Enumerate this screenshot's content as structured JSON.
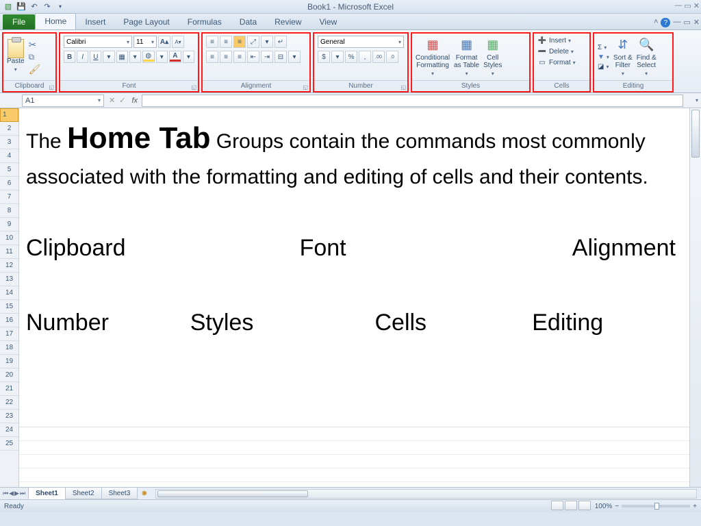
{
  "title": "Book1  -  Microsoft Excel",
  "tabs": {
    "file": "File",
    "list": [
      "Home",
      "Insert",
      "Page Layout",
      "Formulas",
      "Data",
      "Review",
      "View"
    ],
    "active": "Home"
  },
  "ribbon": {
    "clipboard": {
      "label": "Clipboard",
      "paste": "Paste"
    },
    "font": {
      "label": "Font",
      "name": "Calibri",
      "size": "11",
      "bold": "B",
      "italic": "I",
      "underline": "U"
    },
    "alignment": {
      "label": "Alignment"
    },
    "number": {
      "label": "Number",
      "format": "General",
      "currency": "$",
      "percent": "%",
      "comma": ",",
      "inc": ".00→.0",
      "dec": ".0→.00"
    },
    "styles": {
      "label": "Styles",
      "cond": "Conditional\nFormatting",
      "table": "Format\nas Table",
      "cell": "Cell\nStyles"
    },
    "cells": {
      "label": "Cells",
      "insert": "Insert",
      "delete": "Delete",
      "format": "Format"
    },
    "editing": {
      "label": "Editing",
      "sort": "Sort &\nFilter",
      "find": "Find &\nSelect"
    }
  },
  "namebox": "A1",
  "fx": "fx",
  "body": {
    "p_pre": "The ",
    "p_big": "Home Tab",
    "p_post": " Groups contain the commands most commonly associated with the formatting and editing of cells and their contents.",
    "words": [
      "Clipboard",
      "Font",
      "Alignment",
      "Number",
      "Styles",
      "Cells",
      "Editing"
    ]
  },
  "sheets": [
    "Sheet1",
    "Sheet2",
    "Sheet3"
  ],
  "status": {
    "ready": "Ready",
    "zoom": "100%"
  }
}
